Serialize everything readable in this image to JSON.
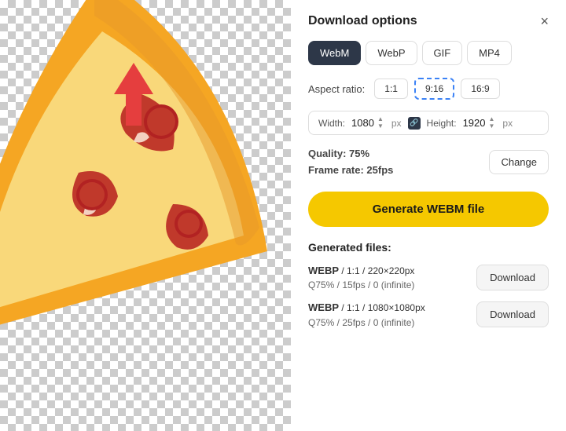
{
  "panel": {
    "title": "Download options",
    "close_label": "×"
  },
  "format_tabs": [
    {
      "id": "webm",
      "label": "WebM",
      "active": true
    },
    {
      "id": "webp",
      "label": "WebP",
      "active": false
    },
    {
      "id": "gif",
      "label": "GIF",
      "active": false
    },
    {
      "id": "mp4",
      "label": "MP4",
      "active": false
    }
  ],
  "aspect": {
    "label": "Aspect ratio:",
    "options": [
      {
        "id": "1:1",
        "label": "1:1",
        "active": false
      },
      {
        "id": "9:16",
        "label": "9:16",
        "active": true
      },
      {
        "id": "16:9",
        "label": "16:9",
        "active": false
      }
    ]
  },
  "dimensions": {
    "width_label": "Width:",
    "width_value": "1080",
    "height_label": "Height:",
    "height_value": "1920",
    "unit": "px"
  },
  "quality": {
    "quality_label": "Quality:",
    "quality_value": "75%",
    "framerate_label": "Frame rate:",
    "framerate_value": "25fps",
    "change_label": "Change"
  },
  "generate_btn_label": "Generate WEBM file",
  "generated_files": {
    "title": "Generated files:",
    "files": [
      {
        "format": "WEBP",
        "ratio": "1:1",
        "resolution": "220×220px",
        "quality": "Q75%",
        "fps": "15fps",
        "loop": "0 (infinite)",
        "download_label": "Download"
      },
      {
        "format": "WEBP",
        "ratio": "1:1",
        "resolution": "1080×1080px",
        "quality": "Q75%",
        "fps": "25fps",
        "loop": "0 (infinite)",
        "download_label": "Download"
      }
    ]
  }
}
